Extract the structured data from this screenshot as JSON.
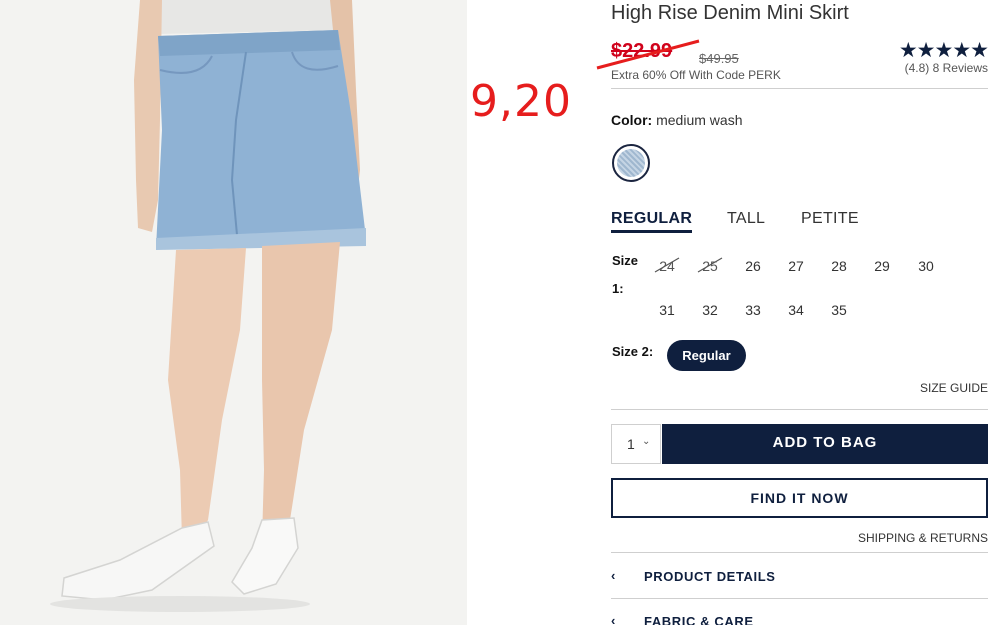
{
  "annotation": "9,20",
  "product": {
    "title": "High Rise Denim Mini Skirt",
    "sale_price": "$22.99",
    "original_price": "$49.95",
    "promo": "Extra 60% Off With Code PERK",
    "stars": "★★★★★",
    "rating_text": "(4.8) 8 Reviews"
  },
  "color": {
    "label": "Color:",
    "value": "medium wash"
  },
  "fit_tabs": [
    {
      "label": "REGULAR",
      "active": true
    },
    {
      "label": "TALL",
      "active": false
    },
    {
      "label": "PETITE",
      "active": false
    }
  ],
  "size1": {
    "label_a": "Size",
    "label_b": "1:",
    "row1": [
      {
        "value": "24",
        "available": false
      },
      {
        "value": "25",
        "available": false
      },
      {
        "value": "26",
        "available": true
      },
      {
        "value": "27",
        "available": true
      },
      {
        "value": "28",
        "available": true
      },
      {
        "value": "29",
        "available": true
      },
      {
        "value": "30",
        "available": true
      }
    ],
    "row2": [
      {
        "value": "31",
        "available": true
      },
      {
        "value": "32",
        "available": true
      },
      {
        "value": "33",
        "available": true
      },
      {
        "value": "34",
        "available": true
      },
      {
        "value": "35",
        "available": true
      }
    ]
  },
  "size2": {
    "label": "Size 2:",
    "selected": "Regular"
  },
  "size_guide": "SIZE GUIDE",
  "quantity": "1",
  "add_to_bag": "ADD TO BAG",
  "find_it_now": "FIND IT NOW",
  "shipping_returns": "SHIPPING & RETURNS",
  "accordion": [
    {
      "label": "PRODUCT DETAILS"
    },
    {
      "label": "FABRIC & CARE"
    }
  ],
  "icons": {
    "chevron_left": "‹",
    "chevron_down": "⌄"
  },
  "colors": {
    "navy": "#0f1f3e",
    "sale_red": "#d0021b",
    "annotation_red": "#e61d1d",
    "denim": "#8fb2d4"
  }
}
